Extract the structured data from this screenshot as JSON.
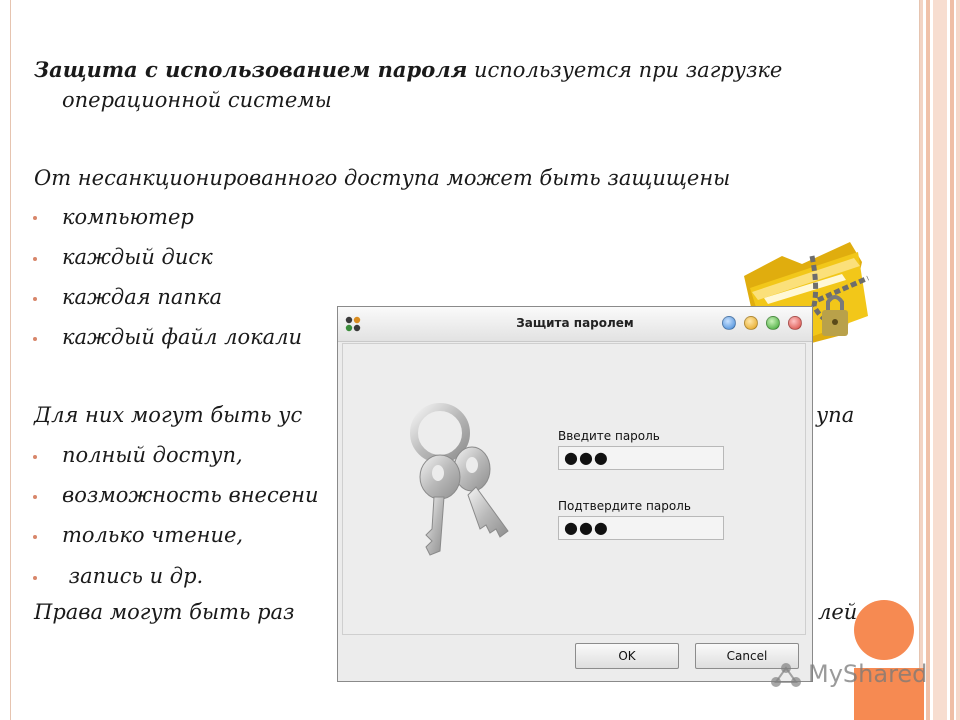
{
  "slide": {
    "heading_bold": "Защита с использованием пароля",
    "heading_rest": " используется при загрузке",
    "heading_line2": "операционной системы",
    "intro": "От несанкционированного доступа может быть защищены",
    "bullets_protected": [
      "компьютер",
      "каждый диск",
      "каждая папка",
      "каждый файл локали"
    ],
    "rights_intro": "Для них могут быть ус",
    "rights_intro_tail": "упа",
    "bullets_rights": [
      "полный доступ,",
      "возможность внесени",
      "только чтение,",
      " запись и др."
    ],
    "footer_text": "Права могут быть раз",
    "footer_tail": "лей."
  },
  "dialog": {
    "title": "Защита паролем",
    "enter_label": "Введите пароль",
    "enter_value": "●●●",
    "confirm_label": "Подтвердите пароль",
    "confirm_value": "●●●",
    "ok_label": "OK",
    "cancel_label": "Cancel"
  },
  "watermark": {
    "text": "MyShared"
  },
  "colors": {
    "accent": "#f68a52",
    "bullet": "#d8866a",
    "folder": "#f2c719"
  }
}
